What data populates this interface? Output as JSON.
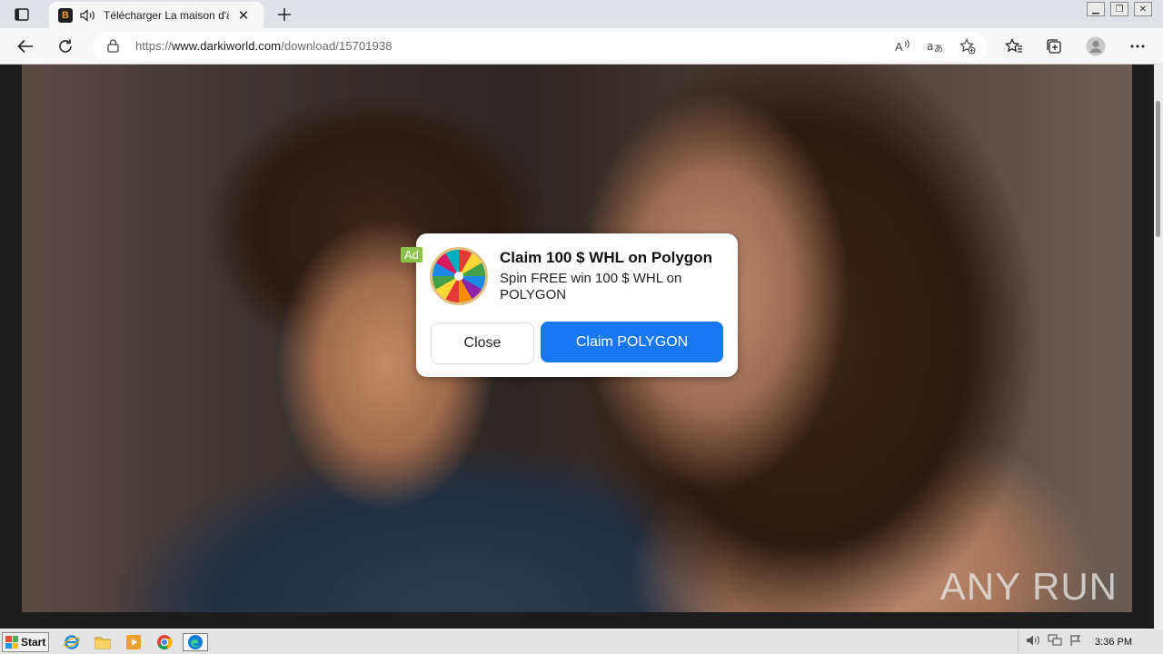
{
  "browser": {
    "tab": {
      "favicon_letter": "B",
      "title": "Télécharger La maison d'à"
    },
    "address": {
      "protocol": "https://",
      "host": "www.darkiworld.com",
      "path": "/download/15701938"
    }
  },
  "page": {
    "watermark": "ANY RUN"
  },
  "ad": {
    "tag": "Ad",
    "title": "Claim 100 $ WHL on Polygon",
    "body": "Spin FREE win 100 $ WHL on POLYGON",
    "close_label": "Close",
    "claim_label": "Claim POLYGON",
    "claim_color": "#1877f2"
  },
  "taskbar": {
    "start_label": "Start",
    "clock": "3:36 PM"
  }
}
